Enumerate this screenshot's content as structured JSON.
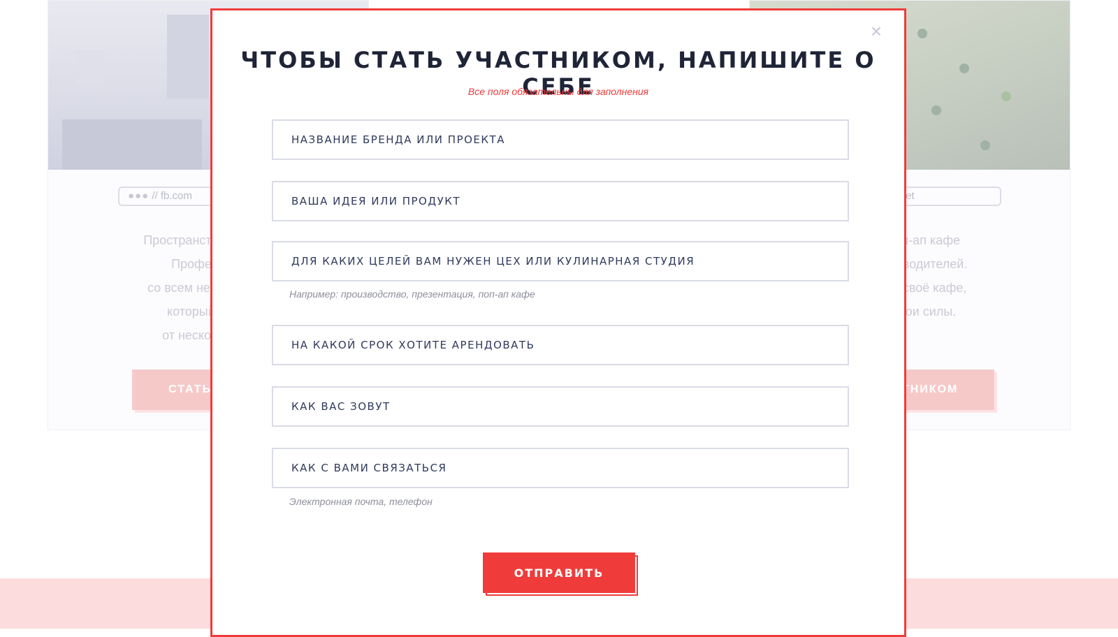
{
  "background": {
    "left_card": {
      "url_dots": "●●●",
      "url_text": "// fb.com",
      "desc_lines": [
        "Пространство для зап",
        "Профессион",
        "со всем необходимы",
        "который можн",
        "от нескольких д"
      ],
      "button_label": "СТАТЬ РЕЗ"
    },
    "right_card": {
      "url_text": "/cityfoodmarket",
      "desc_lines": [
        "ркет поп-ап кафе",
        "их производителей.",
        "открыть своё кафе,",
        "вать свои силы."
      ],
      "button_label": "АСТНИКОМ"
    }
  },
  "modal": {
    "close_glyph": "×",
    "title": "ЧТОБЫ СТАТЬ УЧАСТНИКОМ, НАПИШИТЕ О СЕБЕ",
    "subtitle": "Все поля обязательны для заполнения",
    "fields": [
      {
        "placeholder": "НАЗВАНИЕ БРЕНДА ИЛИ ПРОЕКТА",
        "value": ""
      },
      {
        "placeholder": "ВАША ИДЕЯ ИЛИ ПРОДУКТ",
        "value": ""
      },
      {
        "placeholder": "ДЛЯ КАКИХ ЦЕЛЕЙ ВАМ НУЖЕН ЦЕХ ИЛИ КУЛИНАРНАЯ СТУДИЯ",
        "value": ""
      },
      {
        "placeholder": "НА КАКОЙ СРОК ХОТИТЕ АРЕНДОВАТЬ",
        "value": ""
      },
      {
        "placeholder": "КАК ВАС ЗОВУТ",
        "value": ""
      },
      {
        "placeholder": "КАК С ВАМИ СВЯЗАТЬСЯ",
        "value": ""
      }
    ],
    "hint_purpose": "Например: производство, презентация, поп-ап кафе",
    "hint_contact": "Электронная почта, телефон",
    "submit_label": "ОТПРАВИТЬ"
  },
  "colors": {
    "accent": "#f03b3b",
    "title": "#1f2437",
    "field_border": "#d9dbe6"
  }
}
